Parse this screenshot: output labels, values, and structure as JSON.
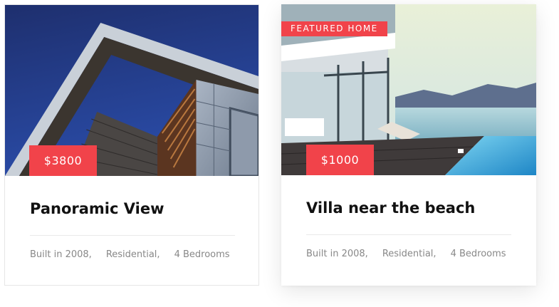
{
  "listings": [
    {
      "price": "$3800",
      "title": "Panoramic View",
      "meta": [
        "Built in 2008,",
        "Residential,",
        "4 Bedrooms"
      ],
      "image": "modern-building-photo"
    },
    {
      "badge": "FEATURED HOME",
      "price": "$1000",
      "title": "Villa near the beach",
      "meta": [
        "Built in 2008,",
        "Residential,",
        "4 Bedrooms"
      ],
      "image": "beach-villa-pool-photo"
    }
  ],
  "colors": {
    "accent": "#f1434a",
    "title": "#111111",
    "meta": "#888888"
  }
}
